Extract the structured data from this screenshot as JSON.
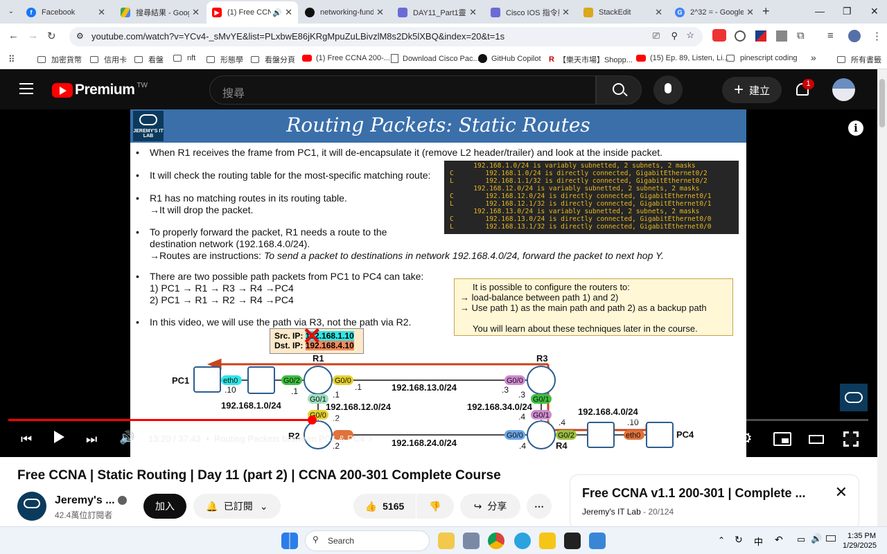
{
  "browser": {
    "tabs": [
      {
        "title": "Facebook",
        "icon": "facebook-icon",
        "color": "#1877f2"
      },
      {
        "title": "搜尋結果 - Goog",
        "icon": "google-drive-icon",
        "color": "#34a853"
      },
      {
        "title": "(1) Free CCNA",
        "icon": "youtube-icon",
        "color": "#ff0000",
        "active": true
      },
      {
        "title": "networking-fund",
        "icon": "github-icon",
        "color": "#111111"
      },
      {
        "title": "DAY11_Part1靈鯊",
        "icon": "notebook-icon",
        "color": "#6b6bd6"
      },
      {
        "title": "Cisco IOS 指令與",
        "icon": "notebook-icon",
        "color": "#6b6bd6"
      },
      {
        "title": "StackEdit",
        "icon": "stackedit-icon",
        "color": "#d9a81c"
      },
      {
        "title": "2^32 = - Google",
        "icon": "google-icon",
        "color": "#4285f4"
      }
    ],
    "url": "youtube.com/watch?v=YCv4-_sMvYE&list=PLxbwE86jKRgMpuZuLBivzlM8s2Dk5lXBQ&index=20&t=1s",
    "bookmarks": [
      "加密貨幣",
      "信用卡",
      "看盤",
      "nft",
      "形態學",
      "看盤分頁",
      "(1) Free CCNA 200-...",
      "Download Cisco Pac...",
      "GitHub Copilot",
      "【樂天市場】Shopp...",
      "(15) Ep. 89, Listen, Li...",
      "pinescript coding"
    ],
    "bookmarks_more": "»",
    "all_bookmarks": "所有書籤"
  },
  "youtube": {
    "logo_text": "Premium",
    "logo_region": "TW",
    "search_placeholder": "搜尋",
    "create_label": "建立",
    "notification_count": "1"
  },
  "slide": {
    "logo_text": "JEREMY'S IT LAB",
    "title": "Routing Packets: Static Routes",
    "bullets": [
      "When R1 receives the frame from PC1, it will de-encapsulate it (remove L2 header/trailer) and look at the inside packet.",
      "It will check the routing table for the most-specific matching route:",
      "R1 has no matching routes in its routing table.",
      "→It will drop the packet.",
      "To properly forward the packet, R1 needs a route to the",
      "destination network (192.168.4.0/24).",
      "→Routes are instructions: ",
      "To send a packet to destinations in network 192.168.4.0/24, forward the packet to next hop Y.",
      "There are two possible path packets from PC1 to PC4 can take:",
      "1) PC1 → R1 → R3 → R4 →PC4",
      "2) PC1 → R1 → R2 → R4 →PC4",
      "In this video, we will use the path via R3, not the path via R2."
    ],
    "routing_table": [
      "      192.168.1.0/24 is variably subnetted, 2 subnets, 2 masks",
      "C        192.168.1.0/24 is directly connected, GigabitEthernet0/2",
      "L        192.168.1.1/32 is directly connected, GigabitEthernet0/2",
      "      192.168.12.0/24 is variably subnetted, 2 subnets, 2 masks",
      "C        192.168.12.0/24 is directly connected, GigabitEthernet0/1",
      "L        192.168.12.1/32 is directly connected, GigabitEthernet0/1",
      "      192.168.13.0/24 is variably subnetted, 2 subnets, 2 masks",
      "C        192.168.13.0/24 is directly connected, GigabitEthernet0/0",
      "L        192.168.13.1/32 is directly connected, GigabitEthernet0/0"
    ],
    "note": [
      "It is possible to configure the routers to:",
      "→ load-balance between path 1) and 2)",
      "→ Use path 1) as the main path and path 2) as a backup path",
      "You will learn about these techniques later in the course."
    ],
    "src_ip_label": "Src. IP:",
    "src_ip": "192.168.1.10",
    "dst_ip_label": "Dst. IP:",
    "dst_ip": "192.168.4.10",
    "diagram_labels": {
      "pc1": "PC1",
      "pc4": "PC4",
      "r1": "R1",
      "r2": "R2",
      "r3": "R3",
      "r4": "R4",
      "eth0": "eth0",
      "g02": "G0/2",
      "g00": "G0/0",
      "g01": "G0/1",
      "h10": ".10",
      "h1": ".1",
      "h3": ".3",
      "h4": ".4",
      "h2": ".2",
      "net1": "192.168.1.0/24",
      "net12": "192.168.12.0/24",
      "net13": "192.168.13.0/24",
      "net34": "192.168.34.0/24",
      "net4": "192.168.4.0/24",
      "net24": "192.168.24.0/24"
    }
  },
  "player": {
    "time": "13:20 / 37:43",
    "chapter": "Routing Packets between PC1 & PC4",
    "progress_fraction": 0.353
  },
  "video": {
    "title": "Free CCNA | Static Routing | Day 11 (part 2) | CCNA 200-301 Complete Course",
    "channel": "Jeremy's ...",
    "subscribers": "42.4萬位訂閱者",
    "join_label": "加入",
    "subscribed_label": "已訂閱",
    "likes": "5165",
    "share_label": "分享"
  },
  "playlist": {
    "title": "Free CCNA v1.1 200-301 | Complete ...",
    "owner": "Jeremy's IT Lab",
    "position": "20/124"
  },
  "taskbar": {
    "search_label": "Search",
    "time": "1:35 PM",
    "date": "1/29/2025",
    "ime": "中"
  }
}
